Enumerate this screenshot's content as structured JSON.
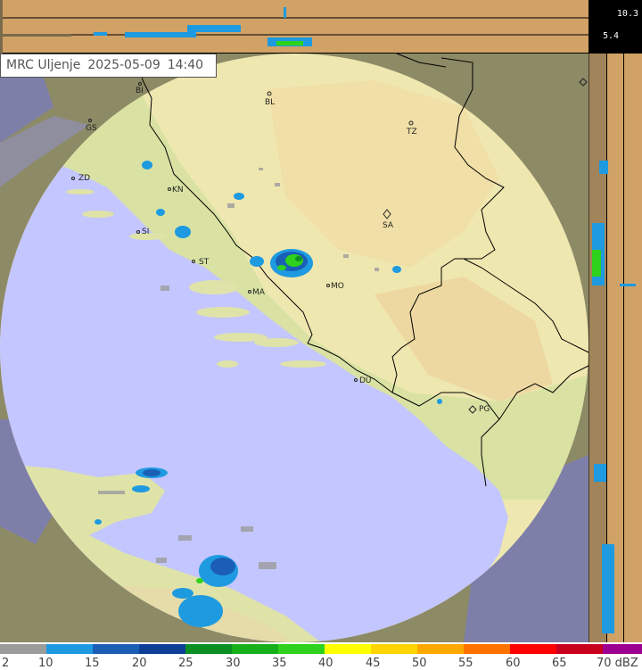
{
  "header": {
    "radar_name": "MRC Uljenje",
    "date": "2025-05-09",
    "time": "14:40"
  },
  "height_scale": {
    "top_value": "10.3",
    "lower_value": "5.4"
  },
  "cities": [
    {
      "code": "BI"
    },
    {
      "code": "BL"
    },
    {
      "code": "GS"
    },
    {
      "code": "TZ"
    },
    {
      "code": "ZD"
    },
    {
      "code": "KN"
    },
    {
      "code": "SA"
    },
    {
      "code": "SI"
    },
    {
      "code": "ST"
    },
    {
      "code": "MA"
    },
    {
      "code": "MO"
    },
    {
      "code": "DU"
    },
    {
      "code": "PG"
    }
  ],
  "legend": {
    "unit": "dBZ",
    "ticks": [
      "2",
      "10",
      "15",
      "20",
      "25",
      "30",
      "35",
      "40",
      "45",
      "50",
      "55",
      "60",
      "65",
      "70 dBZ"
    ],
    "colors": [
      "#9c9c9c",
      "#1e9ae0",
      "#1a5fb5",
      "#0e3f96",
      "#0b8f22",
      "#17b01a",
      "#2ed21c",
      "#ffff00",
      "#ffd400",
      "#ffa800",
      "#ff7200",
      "#ff0000",
      "#c8001e",
      "#9c0090"
    ]
  },
  "colors": {
    "sea": "#c4c6ff",
    "land": "#e6dcaa",
    "outside": "#8d8a66",
    "side_panel": "#d1a266",
    "border": "#000000"
  }
}
